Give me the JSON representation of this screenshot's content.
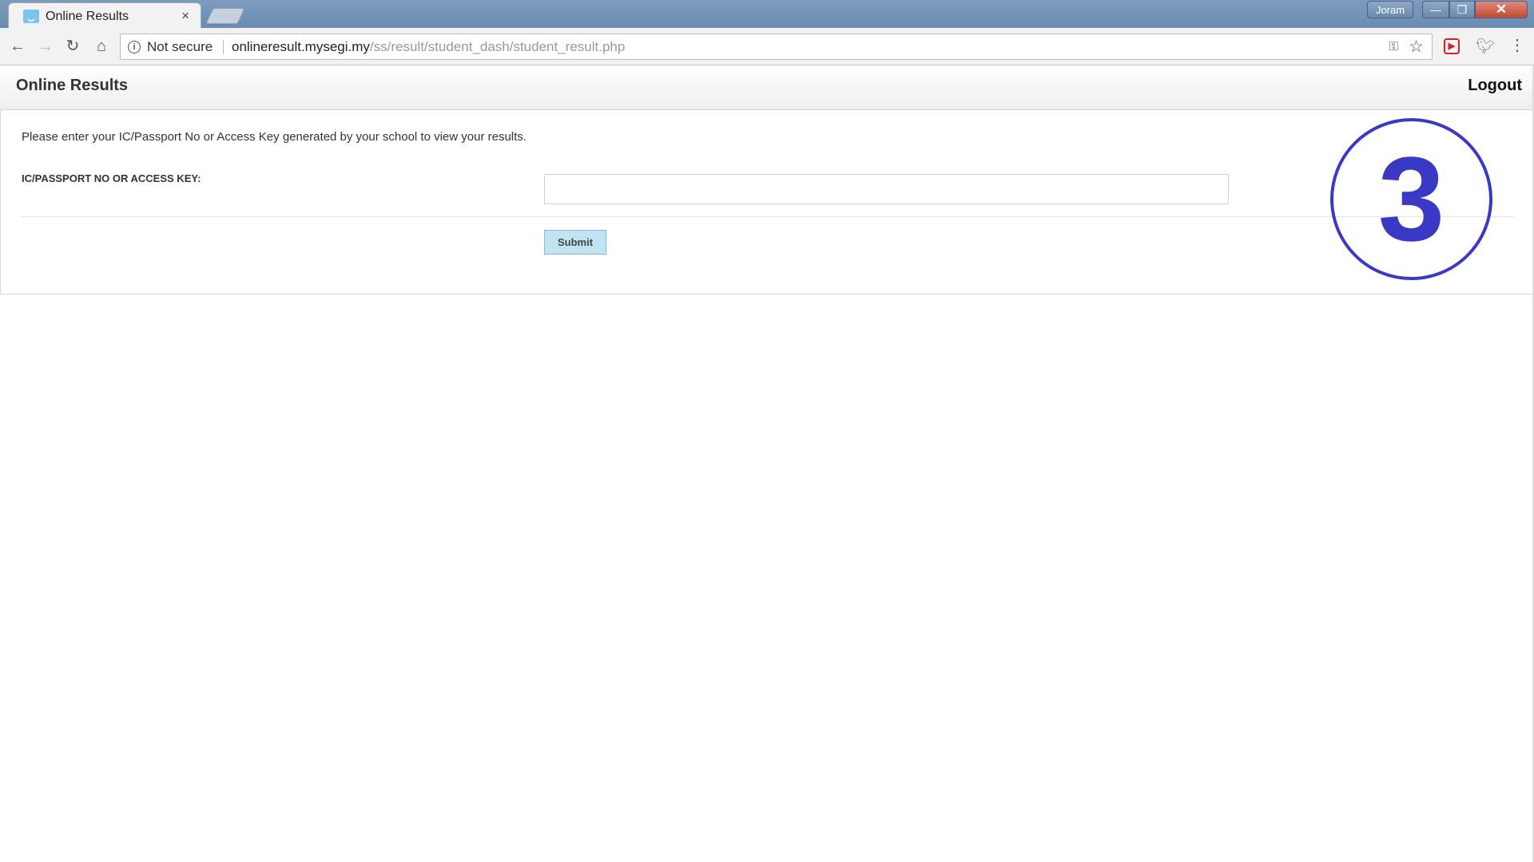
{
  "browser": {
    "tab": {
      "title": "Online Results",
      "close_glyph": "×"
    },
    "user_badge": "Joram",
    "window_controls": {
      "minimize": "—",
      "maximize": "❐",
      "close": "✕"
    },
    "toolbar": {
      "back": "←",
      "forward": "→",
      "reload": "↻",
      "home": "⌂",
      "security_label": "Not secure",
      "url_host": "onlineresult.mysegi.my",
      "url_path": "/ss/result/student_dash/student_result.php"
    },
    "icons": [
      "info-icon",
      "key-icon",
      "star-icon",
      "extension-icon",
      "twitter-icon",
      "menu-icon"
    ]
  },
  "page": {
    "header": {
      "title": "Online Results",
      "logout_label": "Logout"
    },
    "instructions": "Please enter your IC/Passport No or Access Key generated by your school to view your results.",
    "form": {
      "label": "IC/PASSPORT NO OR ACCESS KEY:",
      "value": "",
      "submit_label": "Submit"
    }
  },
  "annotation": {
    "number": "3",
    "color": "#3939c6"
  }
}
